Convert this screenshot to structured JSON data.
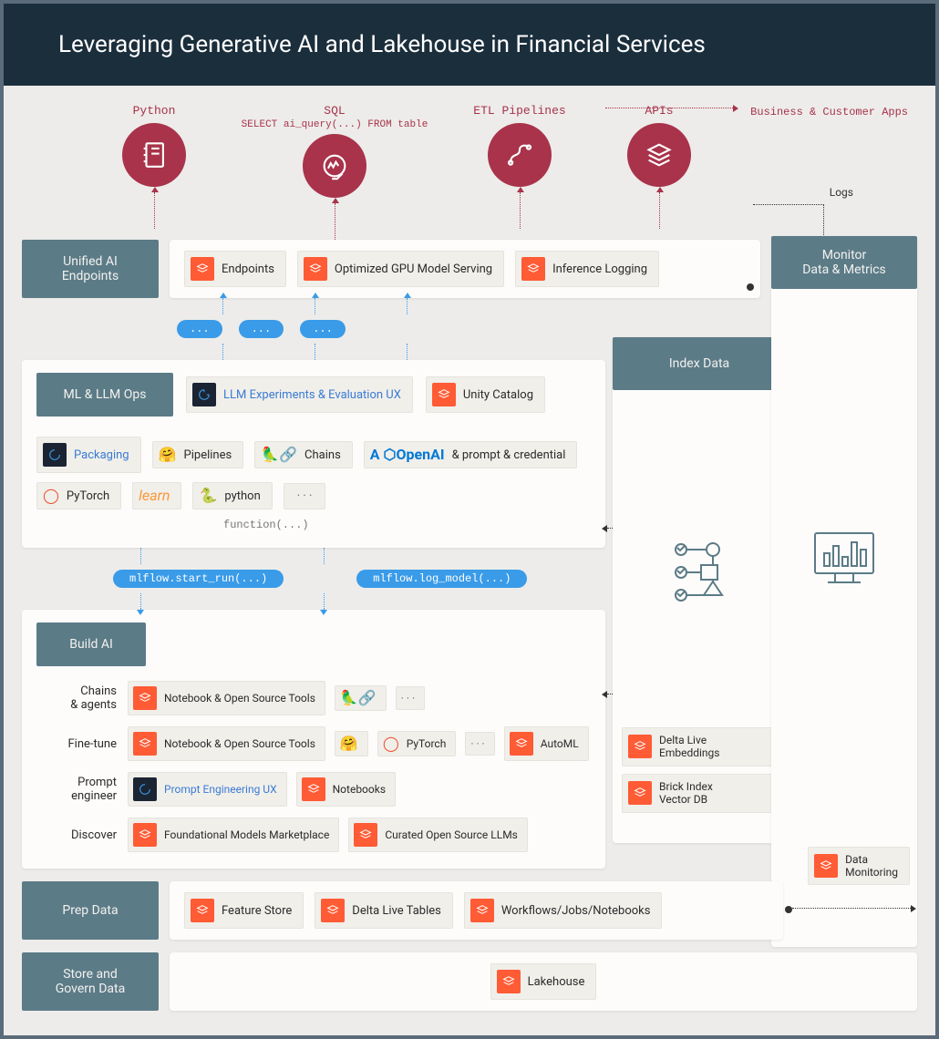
{
  "header": {
    "title": "Leveraging Generative AI and Lakehouse in Financial Services"
  },
  "access": {
    "python": "Python",
    "sql": "SQL",
    "sql_sub": "SELECT ai_query(...) FROM table",
    "etl": "ETL Pipelines",
    "apis": "APIs",
    "biz": "Business & Customer Apps",
    "logs": "Logs"
  },
  "sections": {
    "unified": {
      "label": "Unified AI\nEndpoints",
      "chips": [
        "Endpoints",
        "Optimized GPU Model Serving",
        "Inference Logging"
      ]
    },
    "mlops": {
      "label": "ML & LLM Ops",
      "top_chips": {
        "llm_ux": "LLM Experiments & Evaluation UX",
        "unity": "Unity Catalog"
      },
      "row1": {
        "packaging": "Packaging",
        "pipelines": "Pipelines",
        "chains": "Chains",
        "openai": "& prompt & credential"
      },
      "row2": {
        "pytorch": "PyTorch",
        "learn": "learn",
        "python": "python",
        "dots": "· · ·"
      },
      "func": "function(...)"
    },
    "blue_pills_top": [
      "...",
      "...",
      "..."
    ],
    "blue_pills_mid": [
      "mlflow.start_run(...)",
      "mlflow.log_model(...)"
    ],
    "build": {
      "label": "Build AI",
      "rows": {
        "chains": {
          "label": "Chains\n& agents",
          "chips": [
            "Notebook & Open Source Tools"
          ]
        },
        "finetune": {
          "label": "Fine-tune",
          "chips": [
            "Notebook & Open Source Tools",
            "PyTorch",
            "· · ·",
            "AutoML"
          ]
        },
        "prompt": {
          "label": "Prompt\nengineer",
          "chips": [
            "Prompt Engineering UX",
            "Notebooks"
          ]
        },
        "discover": {
          "label": "Discover",
          "chips": [
            "Foundational Models Marketplace",
            "Curated Open Source LLMs"
          ]
        }
      }
    },
    "index": {
      "label": "Index Data",
      "chips": [
        "Delta Live\nEmbeddings",
        "Brick Index\nVector DB"
      ]
    },
    "monitor": {
      "label": "Monitor\nData & Metrics",
      "chip": "Data\nMonitoring"
    },
    "prep": {
      "label": "Prep Data",
      "chips": [
        "Feature Store",
        "Delta Live Tables",
        "Workflows/Jobs/Notebooks"
      ]
    },
    "store": {
      "label": "Store and\nGovern Data",
      "chip": "Lakehouse"
    }
  }
}
